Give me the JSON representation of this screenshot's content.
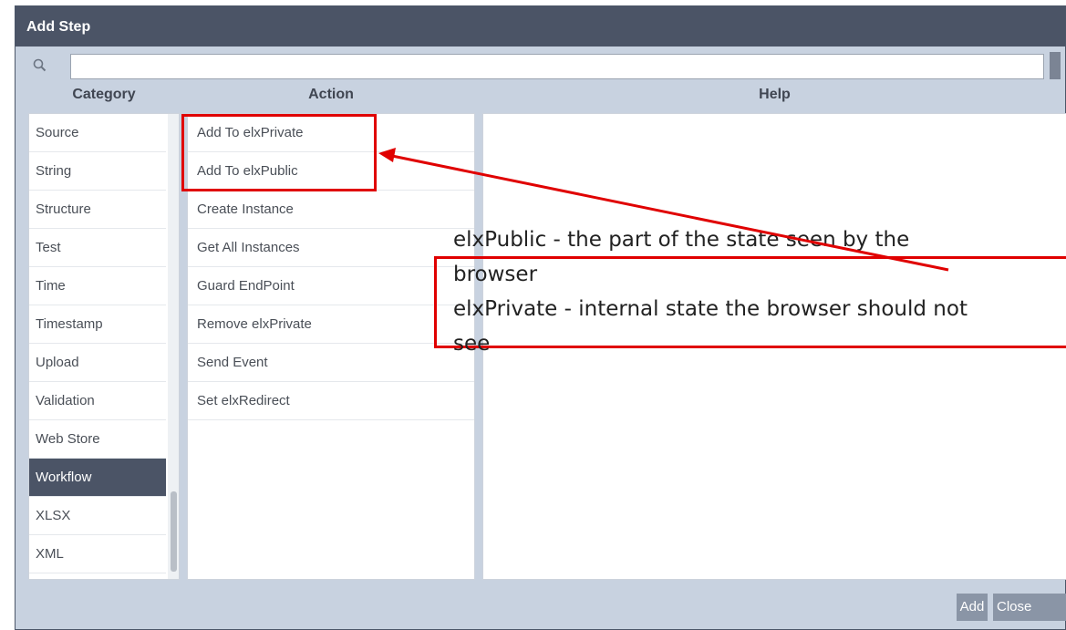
{
  "window": {
    "title": "Add Step"
  },
  "search": {
    "value": "",
    "placeholder": ""
  },
  "columns": {
    "category": "Category",
    "action": "Action",
    "help": "Help"
  },
  "categories": [
    {
      "label": "Source",
      "selected": false
    },
    {
      "label": "String",
      "selected": false
    },
    {
      "label": "Structure",
      "selected": false
    },
    {
      "label": "Test",
      "selected": false
    },
    {
      "label": "Time",
      "selected": false
    },
    {
      "label": "Timestamp",
      "selected": false
    },
    {
      "label": "Upload",
      "selected": false
    },
    {
      "label": "Validation",
      "selected": false
    },
    {
      "label": "Web Store",
      "selected": false
    },
    {
      "label": "Workflow",
      "selected": true
    },
    {
      "label": "XLSX",
      "selected": false
    },
    {
      "label": "XML",
      "selected": false
    }
  ],
  "actions": [
    "Add To elxPrivate",
    "Add To elxPublic",
    "Create Instance",
    "Get All Instances",
    "Guard EndPoint",
    "Remove elxPrivate",
    "Send Event",
    "Set elxRedirect"
  ],
  "buttons": {
    "add": "Add",
    "close": "Close"
  },
  "annotation": {
    "text": "elxPublic - the part of the state seen by the\nbrowser\nelxPrivate - internal state the browser should not\nsee"
  },
  "colors": {
    "accent": "#4b5466",
    "annotation": "#e00000"
  }
}
